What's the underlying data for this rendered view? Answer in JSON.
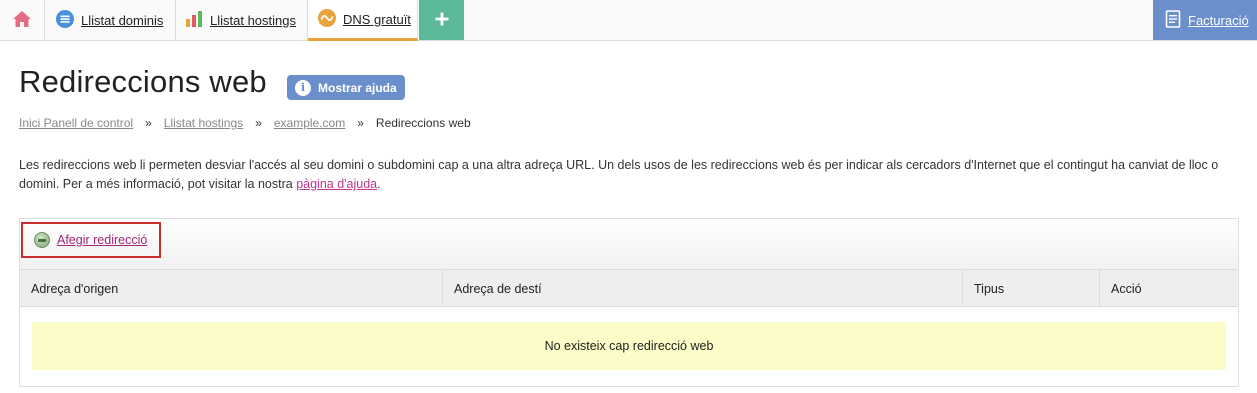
{
  "nav": {
    "home_icon": "home-icon",
    "tabs": [
      {
        "label": "Llistat dominis",
        "icon": "list-icon",
        "color": "#4a90d9"
      },
      {
        "label": "Llistat hostings",
        "icon": "bar-chart-icon",
        "color": "#e8a33c"
      },
      {
        "label": "DNS gratuït",
        "icon": "dns-icon",
        "color": "#e8a33c",
        "active": true
      }
    ],
    "add_symbol": "+",
    "billing_label": "Facturació"
  },
  "page": {
    "title": "Redireccions web",
    "help_button_label": "Mostrar ajuda",
    "help_icon_glyph": "i"
  },
  "breadcrumb": {
    "items": [
      "Inici Panell de control",
      "Llistat hostings",
      "example.com"
    ],
    "current": "Redireccions web",
    "separator": "»"
  },
  "description": {
    "text_before_link": "Les redireccions web li permeten desviar l'accés al seu domini o subdomini cap a una altra adreça URL. Un dels usos de les redireccions web és per indicar als cercadors d'Internet que el contingut ha canviat de lloc o domini. Per a més informació, pot visitar la nostra ",
    "link_text": "pàgina d'ajuda",
    "text_after_link": "."
  },
  "toolbar": {
    "add_redirect_label": "Afegir redirecció"
  },
  "table": {
    "columns": [
      "Adreça d'origen",
      "Adreça de destí",
      "Tipus",
      "Acció"
    ],
    "empty_message": "No existeix cap redirecció web"
  },
  "colors": {
    "accent_blue": "#6a8fcb",
    "accent_green": "#5cb89b",
    "active_tab_underline": "#e8a33c",
    "link_magenta": "#c0338f",
    "highlight_border": "#c6302b",
    "empty_row_bg": "#fcfcc8"
  }
}
